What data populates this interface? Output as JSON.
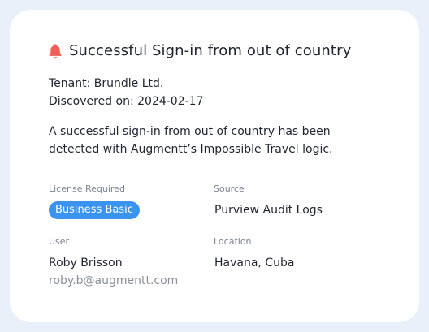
{
  "alert": {
    "icon": "bell-icon",
    "icon_color": "#f25d58",
    "title": "Successful Sign-in from out of country",
    "tenant": "Tenant: Brundle Ltd.",
    "discovered": "Discovered on: 2024-02-17",
    "description": "A successful sign-in from out of country has been detected with Augmentt’s Impossible Travel logic."
  },
  "details": {
    "license_label": "License Required",
    "license_value": "Business Basic",
    "license_badge_color": "#3b93f0",
    "source_label": "Source",
    "source_value": "Purview Audit Logs",
    "user_label": "User",
    "user_name": "Roby Brisson",
    "user_email": "roby.b@augmentt.com",
    "location_label": "Location",
    "location_value": "Havana, Cuba"
  }
}
